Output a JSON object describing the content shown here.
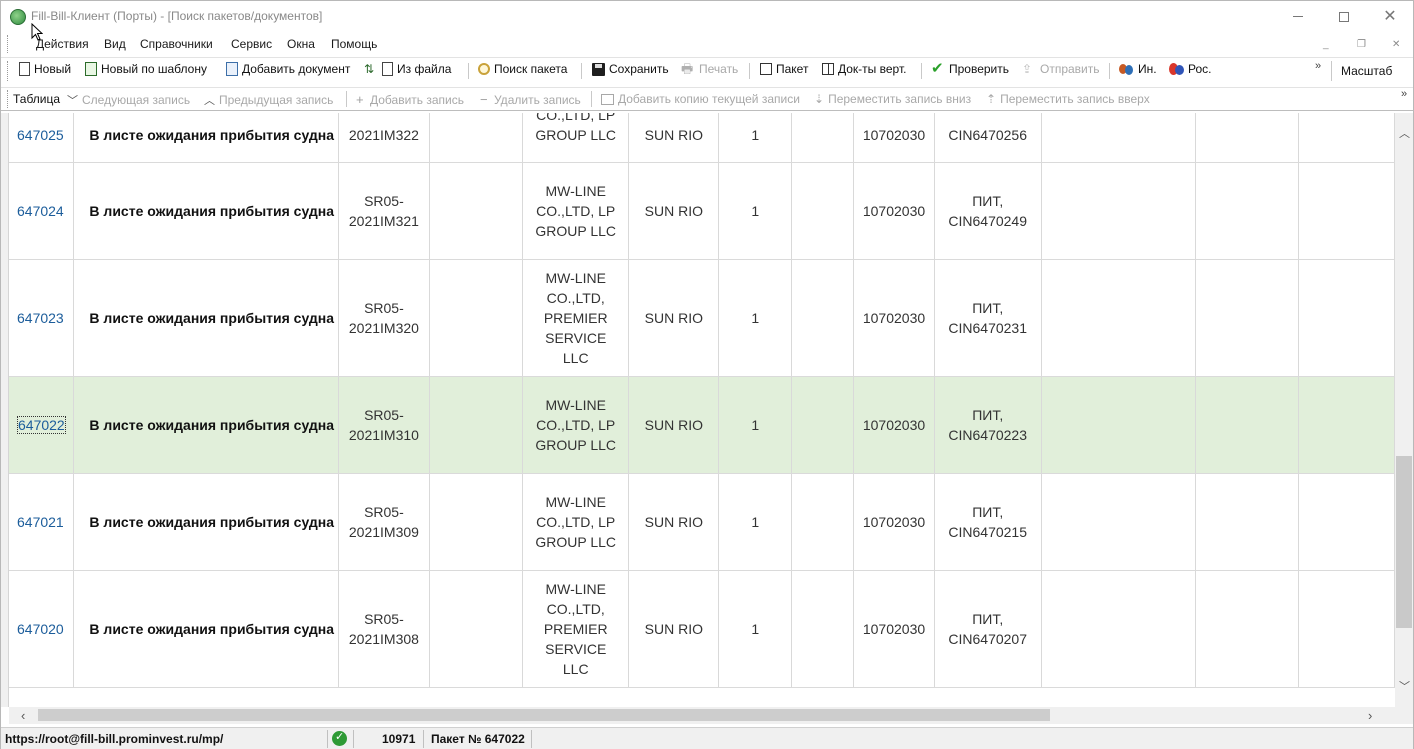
{
  "window": {
    "title": "Fill-Bill-Клиент (Порты) - [Поиск пакетов/документов]"
  },
  "menu": {
    "items": [
      "Действия",
      "Вид",
      "Справочники",
      "Сервис",
      "Окна",
      "Помощь"
    ]
  },
  "toolbar1": {
    "new": "Новый",
    "new_template": "Новый по шаблону",
    "add_document": "Добавить документ",
    "from_file": "Из файла",
    "search_package": "Поиск пакета",
    "save": "Сохранить",
    "print": "Печать",
    "package": "Пакет",
    "docs_vert": "Док-ты верт.",
    "check": "Проверить",
    "send": "Отправить",
    "in": "Ин.",
    "ros": "Рос.",
    "scale": "Масштаб"
  },
  "toolbar2": {
    "table": "Таблица",
    "next": "Следующая запись",
    "prev": "Предыдущая запись",
    "add": "Добавить запись",
    "delete": "Удалить запись",
    "copy": "Добавить копию текущей записи",
    "move_down": "Переместить запись вниз",
    "move_up": "Переместить запись вверх"
  },
  "grid": {
    "rows": [
      {
        "id": "647025",
        "status": "В листе ожидания прибытия судна",
        "ref1": "",
        "ref2": "2021IM322",
        "company": [
          "CO.,LTD, LP",
          "GROUP LLC"
        ],
        "vessel": "SUN RIO",
        "qty": "1",
        "code": "10702030",
        "pit1": "",
        "pit2": "CIN6470256",
        "selected": false,
        "partial": true
      },
      {
        "id": "647024",
        "status": "В листе ожидания прибытия судна",
        "ref1": "SR05-",
        "ref2": "2021IM321",
        "company": [
          "MW-LINE",
          "CO.,LTD, LP",
          "GROUP LLC"
        ],
        "vessel": "SUN RIO",
        "qty": "1",
        "code": "10702030",
        "pit1": "ПИТ,",
        "pit2": "CIN6470249",
        "selected": false
      },
      {
        "id": "647023",
        "status": "В листе ожидания прибытия судна",
        "ref1": "SR05-",
        "ref2": "2021IM320",
        "company": [
          "MW-LINE",
          "CO.,LTD,",
          "PREMIER",
          "SERVICE",
          "LLC"
        ],
        "vessel": "SUN RIO",
        "qty": "1",
        "code": "10702030",
        "pit1": "ПИТ,",
        "pit2": "CIN6470231",
        "selected": false
      },
      {
        "id": "647022",
        "status": "В листе ожидания прибытия судна",
        "ref1": "SR05-",
        "ref2": "2021IM310",
        "company": [
          "MW-LINE",
          "CO.,LTD, LP",
          "GROUP LLC"
        ],
        "vessel": "SUN RIO",
        "qty": "1",
        "code": "10702030",
        "pit1": "ПИТ,",
        "pit2": "CIN6470223",
        "selected": true
      },
      {
        "id": "647021",
        "status": "В листе ожидания прибытия судна",
        "ref1": "SR05-",
        "ref2": "2021IM309",
        "company": [
          "MW-LINE",
          "CO.,LTD, LP",
          "GROUP LLC"
        ],
        "vessel": "SUN RIO",
        "qty": "1",
        "code": "10702030",
        "pit1": "ПИТ,",
        "pit2": "CIN6470215",
        "selected": false
      },
      {
        "id": "647020",
        "status": "В листе ожидания прибытия судна",
        "ref1": "SR05-",
        "ref2": "2021IM308",
        "company": [
          "MW-LINE",
          "CO.,LTD,",
          "PREMIER",
          "SERVICE",
          "LLC"
        ],
        "vessel": "SUN RIO",
        "qty": "1",
        "code": "10702030",
        "pit1": "ПИТ,",
        "pit2": "CIN6470207",
        "selected": false
      }
    ]
  },
  "statusbar": {
    "url": "https://root@fill-bill.prominvest.ru/mp/",
    "count": "10971",
    "package": "Пакет № 647022"
  },
  "colors": {
    "selected_row": "#e1efda",
    "id_link": "#1c5d9b",
    "accent_green": "#2e9a35"
  }
}
